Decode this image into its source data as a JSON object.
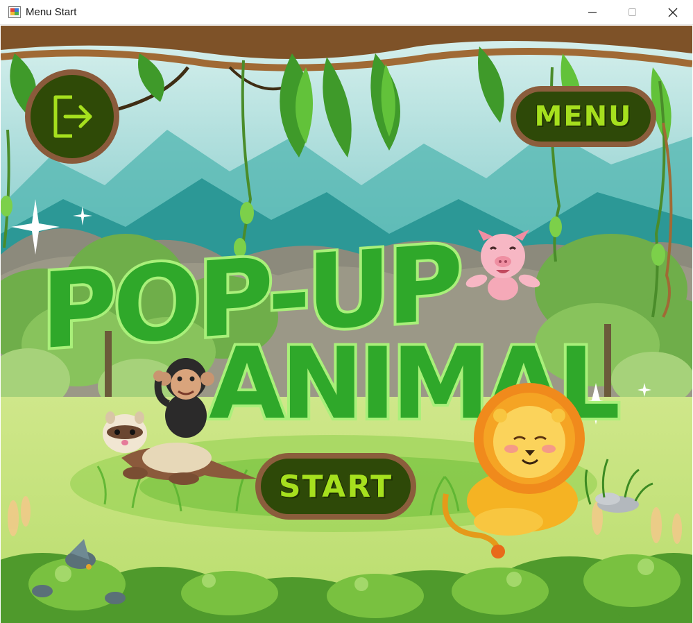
{
  "window": {
    "title": "Menu Start",
    "controls": {
      "minimize": "minimize-icon",
      "maximize": "maximize-icon",
      "close": "close-icon"
    }
  },
  "game": {
    "title_line1": "POP-UP",
    "title_line2": "ANIMAL",
    "buttons": {
      "exit_icon": "exit-door-icon",
      "menu_label": "MENU",
      "start_label": "START"
    },
    "characters": [
      "pig",
      "monkey",
      "ferret",
      "lion"
    ],
    "colors": {
      "button_fill": "#2e4908",
      "button_border": "#8b5d3c",
      "button_text": "#a6e01e",
      "title_fill": "#2fa82a",
      "title_outline": "#a9f07a"
    }
  }
}
